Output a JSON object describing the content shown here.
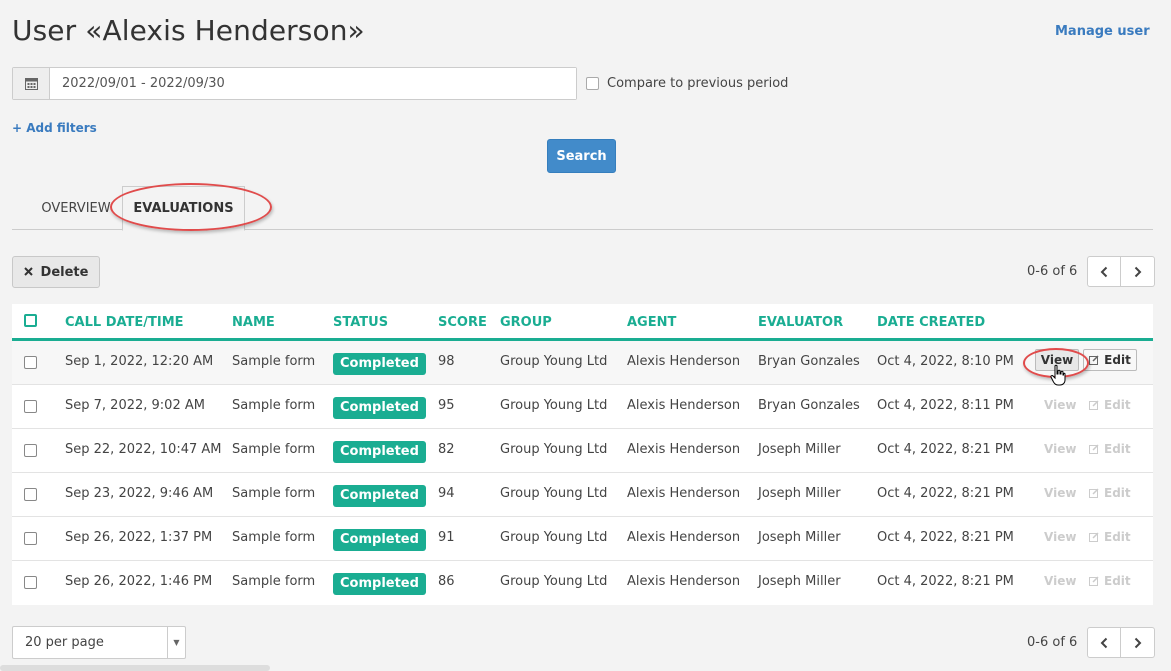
{
  "header": {
    "title": "User «Alexis Henderson»",
    "manage_user": "Manage user"
  },
  "filters": {
    "date_range": "2022/09/01 - 2022/09/30",
    "compare_label": "Compare to previous period",
    "add_filters": "+ Add filters",
    "search_label": "Search"
  },
  "tabs": [
    {
      "label": "OVERVIEW",
      "active": false
    },
    {
      "label": "EVALUATIONS",
      "active": true
    }
  ],
  "toolbar": {
    "delete_label": "Delete",
    "pager_text": "0-6 of 6"
  },
  "table": {
    "columns": [
      "CALL DATE/TIME",
      "NAME",
      "STATUS",
      "SCORE",
      "GROUP",
      "AGENT",
      "EVALUATOR",
      "DATE CREATED"
    ],
    "rows": [
      {
        "call": "Sep 1, 2022, 12:20 AM",
        "name": "Sample form",
        "status": "Completed",
        "score": "98",
        "group": "Group Young Ltd",
        "agent": "Alexis Henderson",
        "evaluator": "Bryan Gonzales",
        "created": "Oct 4, 2022, 8:10 PM"
      },
      {
        "call": "Sep 7, 2022, 9:02 AM",
        "name": "Sample form",
        "status": "Completed",
        "score": "95",
        "group": "Group Young Ltd",
        "agent": "Alexis Henderson",
        "evaluator": "Bryan Gonzales",
        "created": "Oct 4, 2022, 8:11 PM"
      },
      {
        "call": "Sep 22, 2022, 10:47 AM",
        "name": "Sample form",
        "status": "Completed",
        "score": "82",
        "group": "Group Young Ltd",
        "agent": "Alexis Henderson",
        "evaluator": "Joseph Miller",
        "created": "Oct 4, 2022, 8:21 PM"
      },
      {
        "call": "Sep 23, 2022, 9:46 AM",
        "name": "Sample form",
        "status": "Completed",
        "score": "94",
        "group": "Group Young Ltd",
        "agent": "Alexis Henderson",
        "evaluator": "Joseph Miller",
        "created": "Oct 4, 2022, 8:21 PM"
      },
      {
        "call": "Sep 26, 2022, 1:37 PM",
        "name": "Sample form",
        "status": "Completed",
        "score": "91",
        "group": "Group Young Ltd",
        "agent": "Alexis Henderson",
        "evaluator": "Joseph Miller",
        "created": "Oct 4, 2022, 8:21 PM"
      },
      {
        "call": "Sep 26, 2022, 1:46 PM",
        "name": "Sample form",
        "status": "Completed",
        "score": "86",
        "group": "Group Young Ltd",
        "agent": "Alexis Henderson",
        "evaluator": "Joseph Miller",
        "created": "Oct 4, 2022, 8:21 PM"
      }
    ],
    "view_label": "View",
    "edit_label": "Edit"
  },
  "footer": {
    "per_page": "20 per page",
    "pager_text": "0-6 of 6"
  },
  "colors": {
    "accent": "#1aad92",
    "primary": "#428bca",
    "link": "#3a7bbf",
    "annotation": "#e04b4b"
  }
}
